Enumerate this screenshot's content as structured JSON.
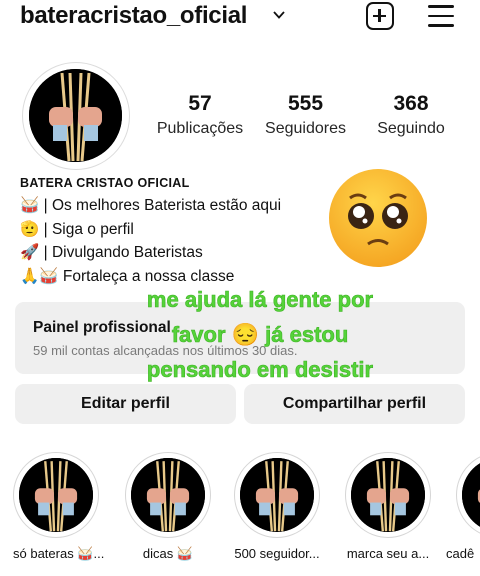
{
  "header": {
    "username": "bateracristao_oficial",
    "icons": [
      "chevron-down-icon",
      "create-post-icon",
      "menu-icon"
    ]
  },
  "stats": [
    {
      "value": "57",
      "label": "Publicações"
    },
    {
      "value": "555",
      "label": "Seguidores"
    },
    {
      "value": "368",
      "label": "Seguindo"
    }
  ],
  "bio": {
    "name": "BATERA CRISTAO OFICIAL",
    "lines": [
      "🥁 | Os melhores Baterista estão aqui",
      "🫡 | Siga o perfil",
      "🚀 | Divulgando Bateristas",
      "🙏🥁 Fortaleça a nossa classe"
    ]
  },
  "professional_panel": {
    "title": "Painel profissional",
    "subtitle": "59 mil contas alcançadas nos últimos 30 dias."
  },
  "buttons": {
    "edit": "Editar perfil",
    "share": "Compartilhar perfil"
  },
  "overlay_text": {
    "line1": "me ajuda lá gente por",
    "line2": "favor 😔 já estou",
    "line3": "pensando em desistir"
  },
  "highlights": [
    {
      "label": "só bateras 🥁..."
    },
    {
      "label": "dicas 🥁"
    },
    {
      "label": "500 seguidor..."
    },
    {
      "label": "marca seu a..."
    },
    {
      "label": "cadê"
    }
  ],
  "colors": {
    "overlay_green": "#55d33a",
    "button_gray": "#efefef",
    "avatar_bg": "#000000"
  }
}
